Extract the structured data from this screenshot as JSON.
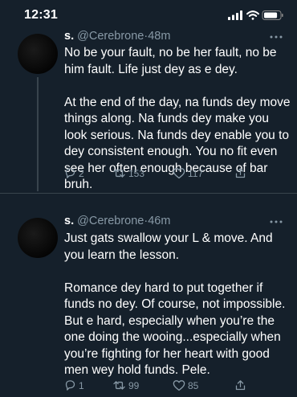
{
  "status_bar": {
    "time": "12:31",
    "icons": [
      "cellular-signal-icon",
      "wifi-icon",
      "battery-icon"
    ],
    "battery_level": 0.85
  },
  "tweets": [
    {
      "author": "s.",
      "handle": "@Cerebrone",
      "time": "48m",
      "paragraphs": [
        "No be your fault, no be her fault, no be him fault. Life just dey as e dey.",
        "At the end of the day, na funds dey move things along. Na funds dey make you look serious. Na funds dey enable you to dey consistent enough. You no fit even see her often enough because of bar bruh."
      ],
      "replies": "2",
      "retweets": "153",
      "likes": "117"
    },
    {
      "author": "s.",
      "handle": "@Cerebrone",
      "time": "46m",
      "paragraphs": [
        "Just gats swallow your L & move. And you learn the lesson.",
        "Romance dey hard to put together if funds no dey. Of course, not impossible. But e hard, especially when you’re the one doing the wooing...especially when you’re fighting for her heart with good men wey hold funds. Pele."
      ],
      "replies": "1",
      "retweets": "99",
      "likes": "85"
    }
  ],
  "colors": {
    "background": "#15202b",
    "text": "#ffffff",
    "muted": "#8899a6",
    "divider": "#38444d"
  }
}
